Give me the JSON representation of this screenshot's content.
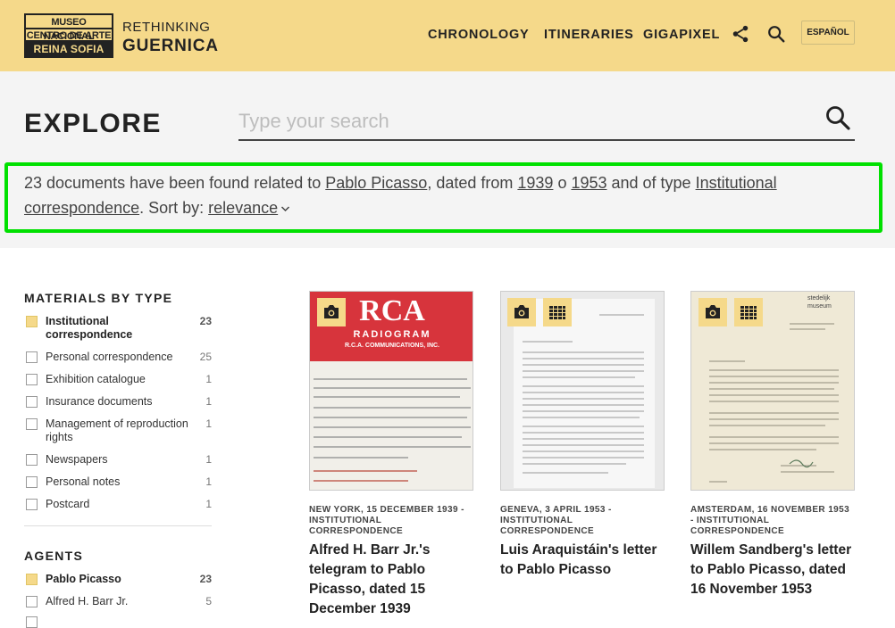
{
  "header": {
    "logo_line1": "MUSEO NACIONAL",
    "logo_line2": "CENTRO DE ARTE",
    "logo_line3": "REINA SOFIA",
    "brand_line1": "RETHINKING",
    "brand_line2": "GUERNICA",
    "nav": [
      "CHRONOLOGY",
      "ITINERARIES",
      "GIGAPIXEL"
    ],
    "language": "ESPAÑOL",
    "share_icon": "share-icon",
    "search_icon": "search-icon"
  },
  "explore": {
    "title": "EXPLORE",
    "search_placeholder": "Type your search",
    "summary": {
      "prefix": "23 documents have been found related to ",
      "agent": "Pablo Picasso",
      "dated_from": ", dated from ",
      "year_from": "1939",
      "or": " o ",
      "year_to": "1953",
      "type_prefix": " and of type ",
      "type": "Institutional correspondence",
      "sort_prefix": ". Sort by: ",
      "sort": "relevance"
    }
  },
  "sidebar": {
    "materials_title": "MATERIALS BY TYPE",
    "materials": [
      {
        "label": "Institutional correspondence",
        "count": "23",
        "checked": true
      },
      {
        "label": "Personal correspondence",
        "count": "25",
        "checked": false
      },
      {
        "label": "Exhibition catalogue",
        "count": "1",
        "checked": false
      },
      {
        "label": "Insurance documents",
        "count": "1",
        "checked": false
      },
      {
        "label": "Management of reproduction rights",
        "count": "1",
        "checked": false
      },
      {
        "label": "Newspapers",
        "count": "1",
        "checked": false
      },
      {
        "label": "Personal notes",
        "count": "1",
        "checked": false
      },
      {
        "label": "Postcard",
        "count": "1",
        "checked": false
      }
    ],
    "agents_title": "AGENTS",
    "agents": [
      {
        "label": "Pablo Picasso",
        "count": "23",
        "checked": true
      },
      {
        "label": "Alfred H. Barr Jr.",
        "count": "5",
        "checked": false
      }
    ]
  },
  "cards": [
    {
      "meta": "NEW YORK, 15 DECEMBER 1939 - INSTITUTIONAL CORRESPONDENCE",
      "title": "Alfred H. Barr Jr.'s telegram to Pablo Picasso, dated 15 December 1939",
      "thumb_heading": "RCA",
      "thumb_sub": "RADIOGRAM",
      "thumb_company": "R.C.A. COMMUNICATIONS, INC."
    },
    {
      "meta": "GENEVA, 3 APRIL 1953 - INSTITUTIONAL CORRESPONDENCE",
      "title": "Luis Araquistáin's letter to Pablo Picasso"
    },
    {
      "meta": "AMSTERDAM, 16 NOVEMBER 1953 - INSTITUTIONAL CORRESPONDENCE",
      "title": "Willem Sandberg's letter to Pablo Picasso, dated 16 November 1953",
      "thumb_letterhead": "stedelijk museum"
    }
  ],
  "colors": {
    "header_bg": "#f5d98a",
    "highlight_border": "#00e000",
    "band_bg": "#f4f4f4"
  }
}
